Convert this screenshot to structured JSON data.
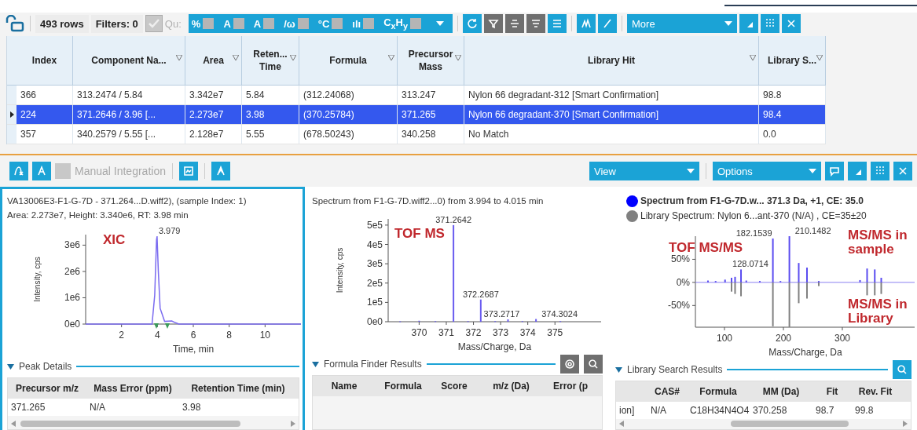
{
  "top_toolbar": {
    "row_count": "493 rows",
    "filters": "Filters: 0",
    "quant_checkbox": {
      "label": "Qu:",
      "checked": true,
      "disabled": true
    },
    "toggles": [
      {
        "glyph": "%"
      },
      {
        "glyph": "A"
      },
      {
        "glyph": "A"
      },
      {
        "glyph": "/ω"
      },
      {
        "glyph": "°C"
      },
      {
        "glyph": "ılı"
      },
      {
        "glyph": "C$_{x}$H$_{y}$"
      }
    ],
    "buttons": [
      {
        "disabled": false
      },
      {
        "disabled": true
      },
      {
        "disabled": true
      },
      {
        "disabled": true
      },
      {
        "disabled": false
      },
      {
        "disabled": false
      },
      {
        "disabled": false
      }
    ],
    "more_dropdown": "More",
    "right_buttons": [
      {
        "disabled": false
      },
      {
        "disabled": false
      },
      {
        "disabled": false
      }
    ]
  },
  "table": {
    "columns": [
      {
        "label": "Index",
        "filter": false
      },
      {
        "label": "Component Na...",
        "filter": true
      },
      {
        "label": "Area",
        "filter": true
      },
      {
        "label": "Reten... Time",
        "filter": true
      },
      {
        "label": "Formula",
        "filter": true
      },
      {
        "label": "Precursor Mass",
        "filter": true
      },
      {
        "label": "Library Hit",
        "filter": true
      },
      {
        "label": "Library S...",
        "filter": true
      }
    ],
    "rows": [
      {
        "selected": false,
        "cells": [
          "366",
          "313.2474 / 5.84",
          "3.342e7",
          "5.84",
          "(312.24068)",
          "313.247",
          "Nylon 66 degradant-312 [Smart Confirmation]",
          "98.8"
        ]
      },
      {
        "selected": true,
        "cells": [
          "224",
          "371.2646 / 3.96  [...",
          "2.273e7",
          "3.98",
          "(370.25784)",
          "371.265",
          "Nylon 66 degradant-370 [Smart Confirmation]",
          "98.4"
        ]
      },
      {
        "selected": false,
        "cells": [
          "357",
          "340.2579 / 5.55  [...",
          "2.128e7",
          "5.55",
          "(678.50243)",
          "340.258",
          "No Match",
          "0.0"
        ]
      }
    ]
  },
  "bottom_toolbar": {
    "left_buttons": [
      {
        "disabled": false
      },
      {
        "disabled": false
      }
    ],
    "manual_integration": {
      "label": "Manual Integration",
      "disabled": true
    },
    "tool_buttons": [
      {
        "disabled": false
      },
      {
        "disabled": false
      }
    ],
    "view_dropdown": "View",
    "options_dropdown": "Options",
    "right_buttons": [
      {
        "disabled": false
      },
      {
        "disabled": false
      },
      {
        "disabled": false
      },
      {
        "disabled": false
      }
    ]
  },
  "panels": [
    {
      "kind": "xic",
      "title_lines": [
        "VA13006E3-F1-G-7D - 371.264...D.wiff2), (sample Index: 1)",
        "Area: 2.273e7, Height: 3.340e6, RT: 3.98 min"
      ],
      "callouts": [
        "XIC"
      ],
      "chart_data": {
        "type": "line",
        "xlabel": "Time, min",
        "ylabel": "Intensity, cps",
        "x": [
          0,
          3.7,
          3.85,
          3.95,
          3.98,
          4.05,
          4.15,
          4.4,
          4.8,
          5.0,
          5.2,
          12
        ],
        "series": [
          {
            "color": "#7b6cf0",
            "values": [
              0,
              0,
              1100000,
              3200000,
              3340000,
              2000000,
              600000,
              100000,
              120000,
              50000,
              0,
              0
            ]
          }
        ],
        "xlim": [
          0,
          12
        ],
        "ylim": [
          0,
          3400000
        ],
        "xticks": [
          2,
          4,
          6,
          8,
          10
        ],
        "yticks": [
          {
            "value": 0,
            "label": "0e0"
          },
          {
            "value": 1000000,
            "label": "1e6"
          },
          {
            "value": 2000000,
            "label": "2e6"
          },
          {
            "value": 3000000,
            "label": "3e6"
          }
        ],
        "annotations": [
          {
            "x": 3.98,
            "y": 3340000,
            "text": "3.979"
          }
        ]
      },
      "section": {
        "title": "Peak Details",
        "expanded": true
      },
      "results": {
        "columns": [
          "Precursor m/z",
          "Mass Error (ppm)",
          "Retention Time (min)"
        ],
        "rows": [
          [
            "371.265",
            "N/A",
            "3.98"
          ]
        ]
      }
    },
    {
      "kind": "ms",
      "title_lines": [
        "Spectrum from F1-G-7D.wiff2...0) from 3.994 to 4.015 min"
      ],
      "callouts": [
        "TOF MS"
      ],
      "chart_data": {
        "type": "bar",
        "xlabel": "Mass/Charge, Da",
        "ylabel": "Intensity, cps",
        "x": [
          369.3,
          370.0,
          370.6,
          371.2642,
          371.8,
          372.2687,
          372.8,
          373.2717,
          373.8,
          374.3024,
          375.2
        ],
        "series": [
          {
            "color": "#6a5cf0",
            "values": [
              2000,
              5000,
              3000,
              500000,
              3000,
              115000,
              3000,
              12000,
              3000,
              14000,
              3000
            ]
          }
        ],
        "xlim": [
          368.86,
          376.7
        ],
        "ylim": [
          0,
          532000
        ],
        "xticks": [
          370,
          371,
          372,
          373,
          374,
          375
        ],
        "yticks": [
          {
            "value": 0,
            "label": "0e0"
          },
          {
            "value": 100000,
            "label": "1e5"
          },
          {
            "value": 200000,
            "label": "2e5"
          },
          {
            "value": 300000,
            "label": "3e5"
          },
          {
            "value": 400000,
            "label": "4e5"
          },
          {
            "value": 500000,
            "label": "5e5"
          }
        ],
        "annotations": [
          {
            "x": 371.2642,
            "y": 500000,
            "text": "371.2642"
          },
          {
            "x": 372.2687,
            "y": 115000,
            "text": "372.2687"
          },
          {
            "x": 373.2717,
            "y": 12000,
            "text": "373.2717"
          },
          {
            "x": 374.3024,
            "y": 14000,
            "text": "374.3024"
          }
        ]
      },
      "section": {
        "title": "Formula Finder Results",
        "expanded": true,
        "buttons": [
          {
            "disabled": true
          },
          {
            "disabled": true
          }
        ]
      },
      "results": {
        "columns": [
          "Name",
          "Formula",
          "Score",
          "m/z (Da)",
          "Error (p"
        ]
      }
    },
    {
      "kind": "msms",
      "legend": [
        {
          "label": "Spectrum from F1-G-7D.w... 371.3 Da, +1, CE: 35.0",
          "color": "#0000ff",
          "bold": true
        },
        {
          "label": "Library Spectrum: Nylon 6...ant-370 (N/A) , CE=35±20",
          "color": "#808080",
          "bold": false
        }
      ],
      "callouts": [
        "TOF MS/MS",
        "MS/MS in sample",
        "MS/MS in Library"
      ],
      "chart_data": {
        "type": "bar",
        "xlabel": "Mass/Charge, Da",
        "x": [
          72,
          85,
          101,
          112,
          118,
          128.07,
          137,
          160,
          182.15,
          195,
          210.15,
          226,
          240,
          260,
          330,
          342,
          355,
          366
        ],
        "series": [
          {
            "color": "#5a4cf0",
            "values": [
              4,
              3,
              6,
              10,
              12,
              28,
              4,
              3,
              95,
              3,
              100,
              42,
              32,
              3,
              5,
              30,
              28,
              10
            ]
          },
          {
            "color": "#808080",
            "values": [
              null,
              null,
              null,
              -20,
              -25,
              -30,
              null,
              null,
              -95,
              null,
              -97,
              -45,
              -35,
              -8,
              null,
              -28,
              -28,
              -25
            ]
          }
        ],
        "ref_lines": [
          {
            "value": 0,
            "axis": "y"
          }
        ],
        "xlim": [
          50.7,
          424
        ],
        "ylim": [
          -97,
          100
        ],
        "xticks": [
          100,
          200,
          300
        ],
        "yticks": [
          {
            "value": -50,
            "label": "-50%"
          },
          {
            "value": 0,
            "label": "0%"
          },
          {
            "value": 50,
            "label": "50%"
          }
        ],
        "annotations": [
          {
            "x": 182.15,
            "y": 95,
            "text": "182.1539"
          },
          {
            "x": 210.15,
            "y": 100,
            "text": "210.1482"
          },
          {
            "x": 128.07,
            "y": 28,
            "text": "128.0714"
          }
        ]
      },
      "section": {
        "title": "Library Search Results",
        "expanded": true,
        "buttons": [
          {
            "disabled": false
          }
        ]
      },
      "results": {
        "columns": [
          "",
          "CAS#",
          "Formula",
          "MM (Da)",
          "Fit",
          "Rev. Fit"
        ],
        "rows": [
          [
            "ion]",
            "N/A",
            "C18H34N4O4",
            "370.258",
            "98.7",
            "99.8"
          ]
        ]
      }
    }
  ]
}
